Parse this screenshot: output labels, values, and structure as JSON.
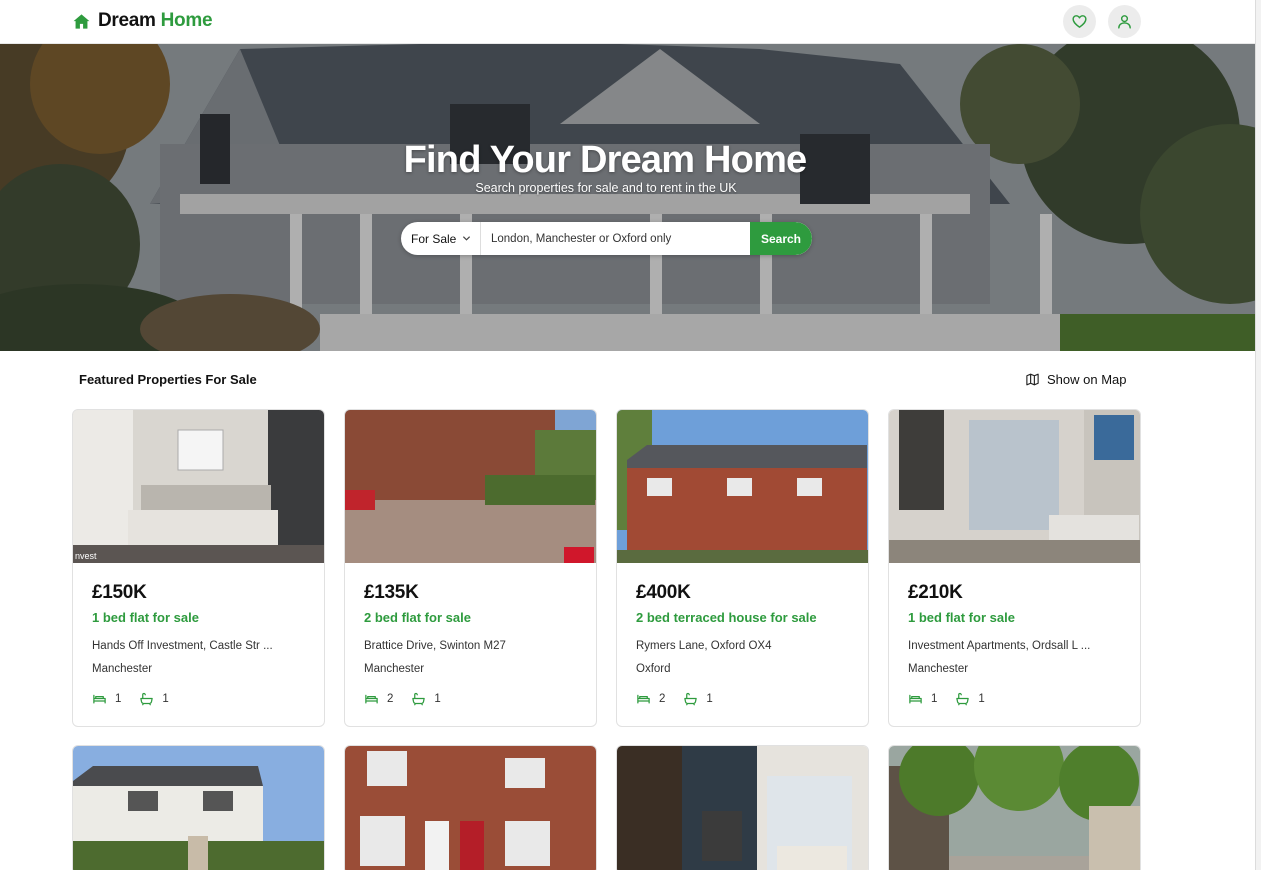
{
  "brand": {
    "name_part1": "Dream",
    "name_part2": "Home",
    "logo_icon": "home-icon",
    "accent": "#2e9b3e"
  },
  "header": {
    "favorites_icon": "heart-icon",
    "account_icon": "user-icon"
  },
  "hero": {
    "title": "Find Your Dream Home",
    "subtitle": "Search properties for sale and to rent in the UK"
  },
  "search": {
    "type_selected": "For Sale",
    "placeholder": "London, Manchester or Oxford only",
    "button_label": "Search"
  },
  "section": {
    "title": "Featured Properties For Sale",
    "map_label": "Show on Map",
    "map_icon": "map-icon"
  },
  "listings": [
    {
      "price": "£150K",
      "type": "1 bed flat for sale",
      "address": "Hands Off Investment, Castle Str ...",
      "city": "Manchester",
      "beds": "1",
      "baths": "1",
      "watermark": "nvest"
    },
    {
      "price": "£135K",
      "type": "2 bed flat for sale",
      "address": "Brattice Drive, Swinton M27",
      "city": "Manchester",
      "beds": "2",
      "baths": "1"
    },
    {
      "price": "£400K",
      "type": "2 bed terraced house for sale",
      "address": "Rymers Lane, Oxford OX4",
      "city": "Oxford",
      "beds": "2",
      "baths": "1"
    },
    {
      "price": "£210K",
      "type": "1 bed flat for sale",
      "address": "Investment Apartments, Ordsall L ...",
      "city": "Manchester",
      "beds": "1",
      "baths": "1"
    }
  ]
}
